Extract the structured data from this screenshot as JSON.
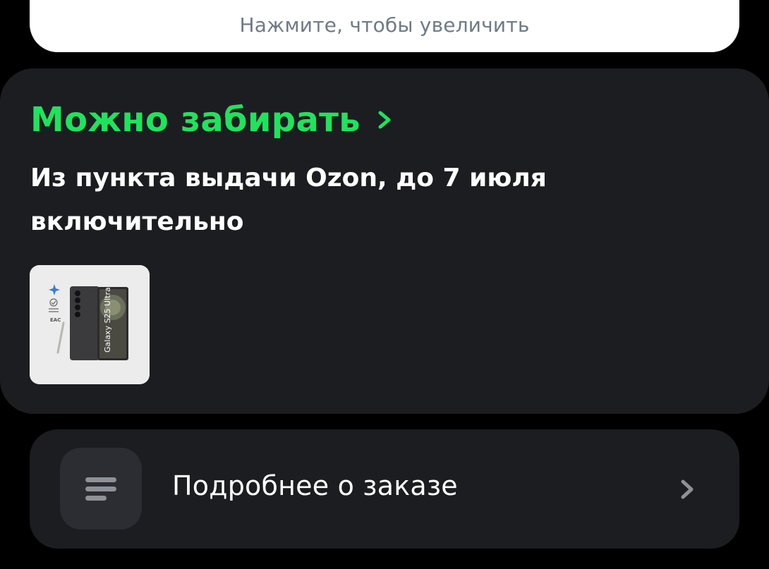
{
  "zoom_card": {
    "hint": "Нажмите, чтобы увеличить"
  },
  "status": {
    "title": "Можно забирать",
    "description": "Из пункта выдачи Ozon, до 7 июля включительно",
    "accent_color": "#1fe35d",
    "product": {
      "name": "Galaxy S25 Ultra",
      "icon": "product-image"
    }
  },
  "details": {
    "label": "Подробнее о заказе",
    "icon": "list-icon"
  }
}
